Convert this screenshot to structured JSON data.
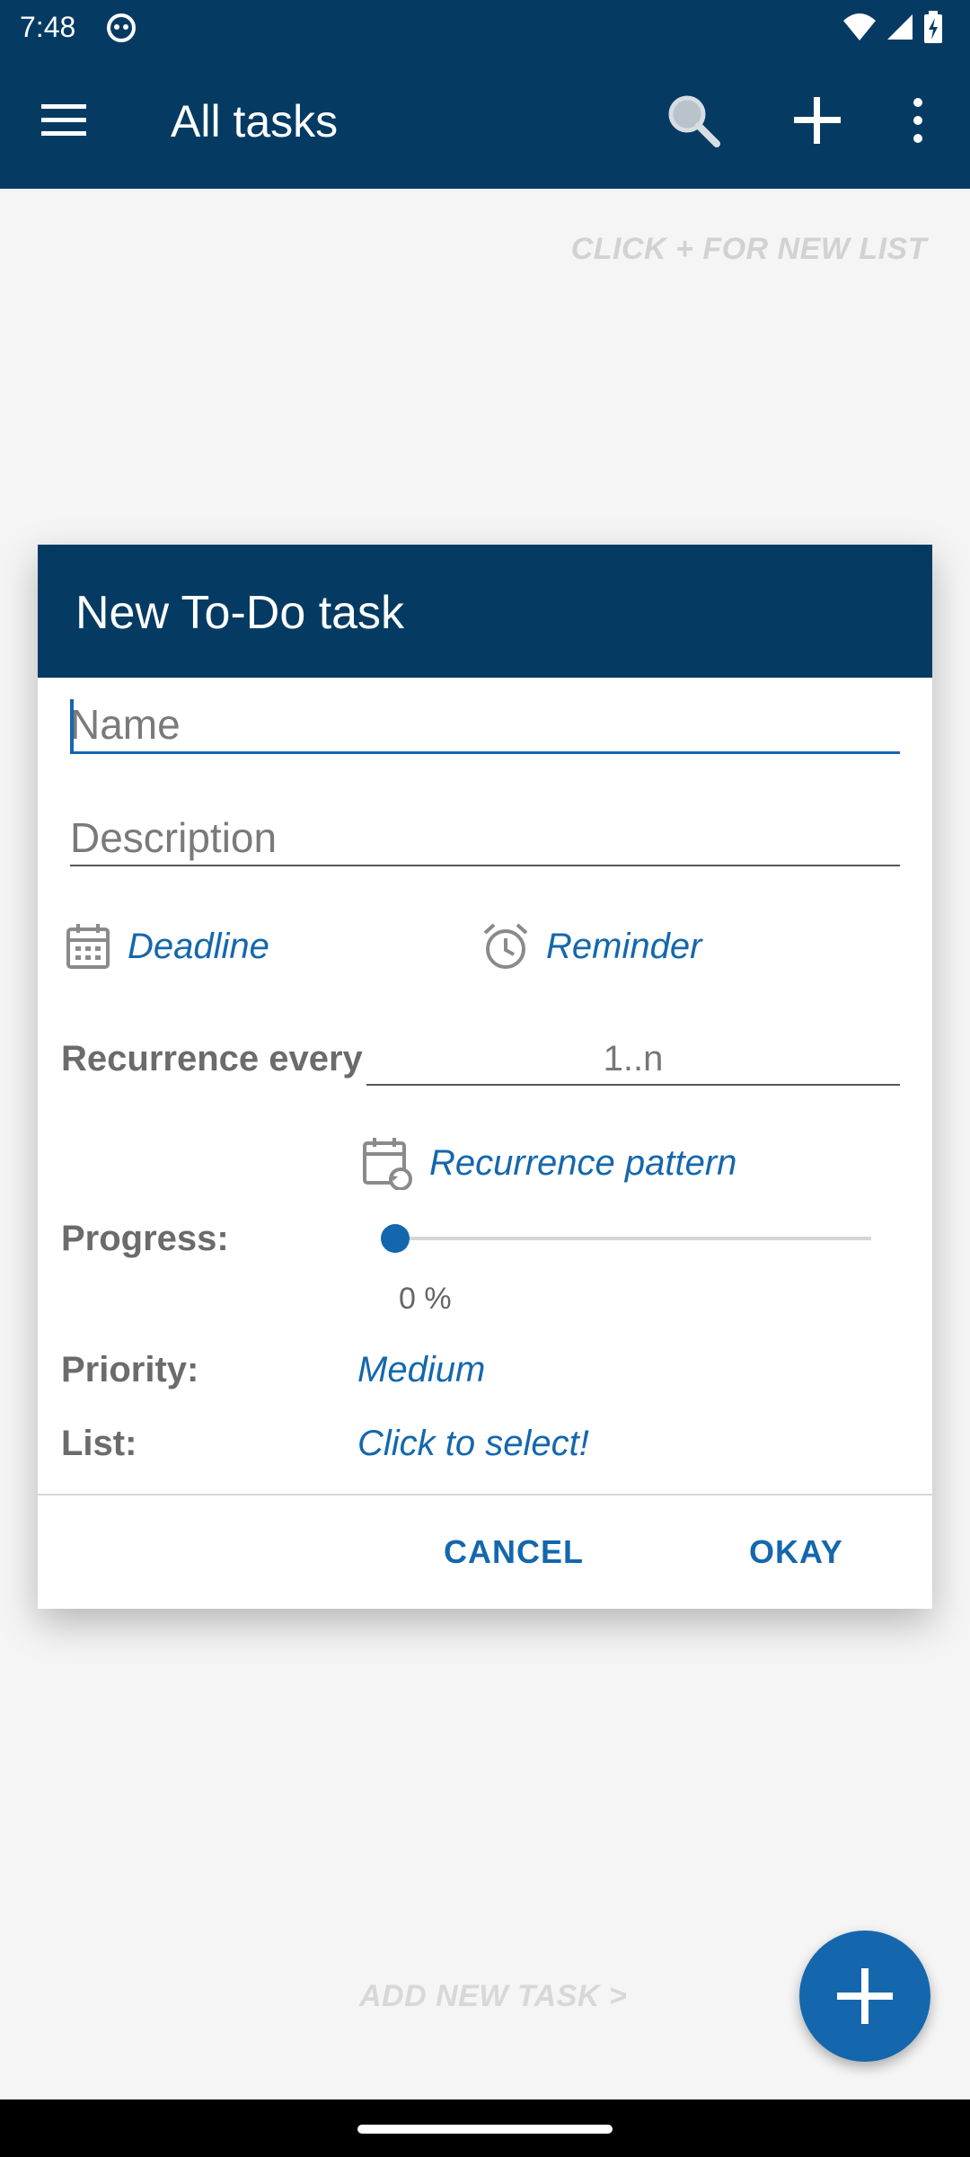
{
  "status_bar": {
    "time": "7:48"
  },
  "app_bar": {
    "title": "All tasks"
  },
  "hints": {
    "new_list": "CLICK + FOR NEW LIST",
    "new_task": "ADD NEW TASK >"
  },
  "dialog": {
    "title": "New To-Do task",
    "name_placeholder": "Name",
    "description_placeholder": "Description",
    "deadline_label": "Deadline",
    "reminder_label": "Reminder",
    "recurrence_label": "Recurrence every",
    "recurrence_value": "1..n",
    "recurrence_pattern_label": "Recurrence pattern",
    "progress_label": "Progress:",
    "progress_value": 0,
    "progress_text": "0 %",
    "priority_label": "Priority:",
    "priority_value": "Medium",
    "list_label": "List:",
    "list_value": "Click to select!",
    "cancel_label": "CANCEL",
    "okay_label": "OKAY"
  },
  "colors": {
    "primary_dark": "#053b63",
    "accent": "#1467ad"
  }
}
